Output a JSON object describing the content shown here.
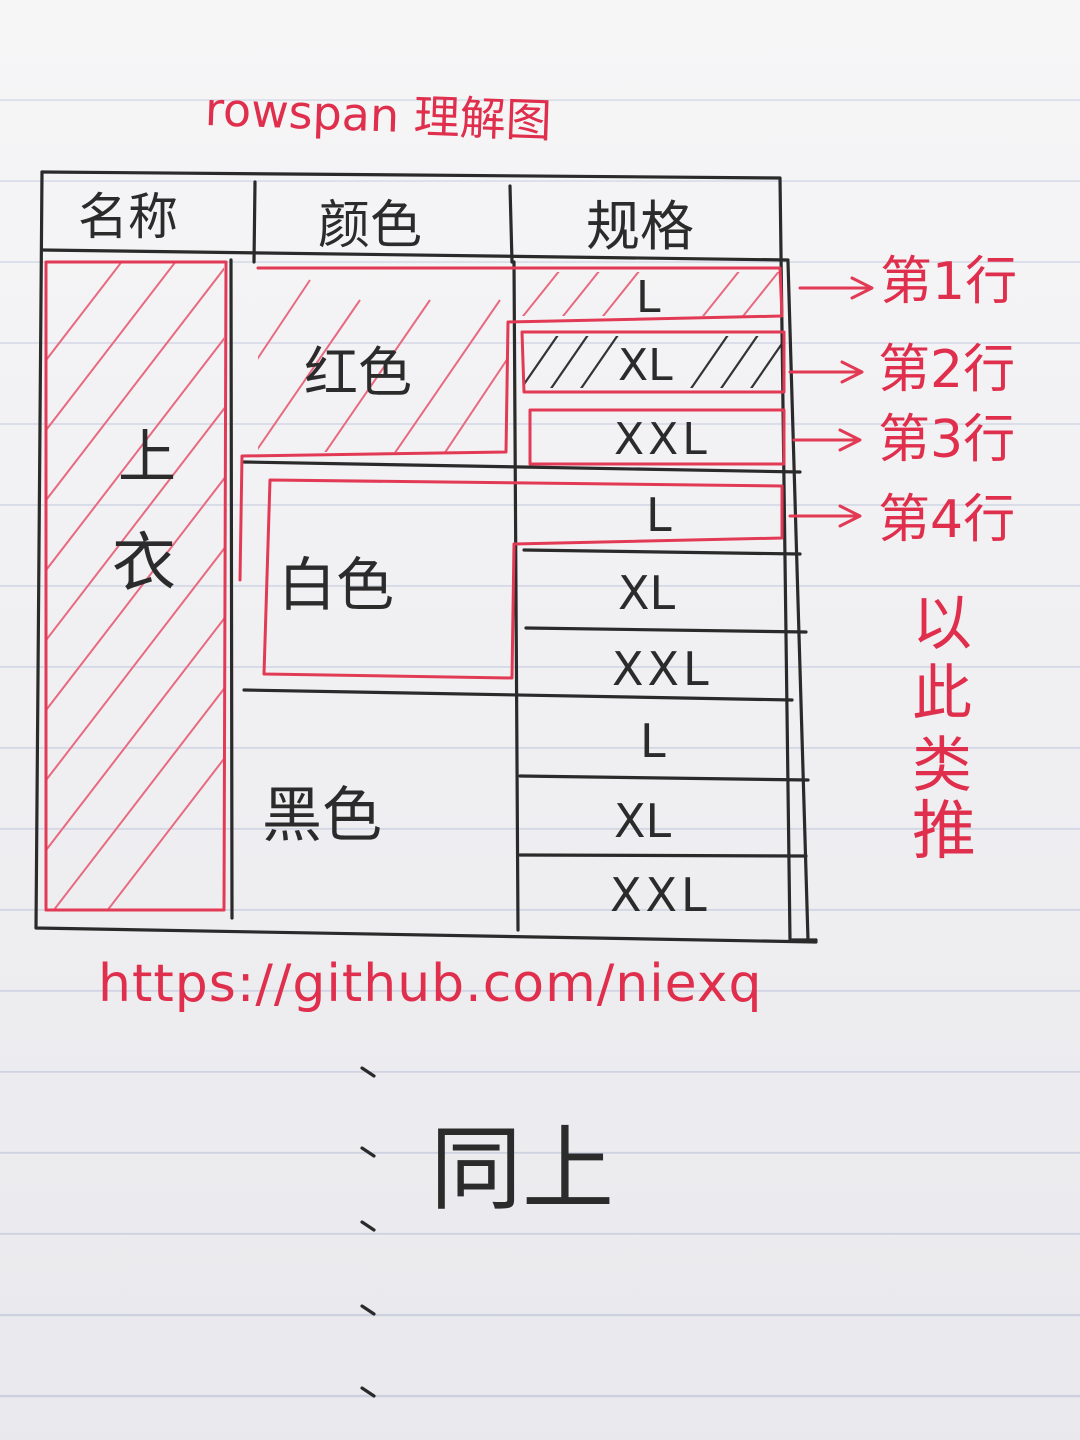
{
  "title": "rowspan 理解图",
  "table": {
    "headers": [
      "名称",
      "颜色",
      "规格"
    ],
    "name_cell": [
      "上",
      "衣"
    ],
    "colors": [
      "红色",
      "白色",
      "黑色"
    ],
    "sizes": [
      "L",
      "XL",
      "XXL",
      "L",
      "XL",
      "XXL",
      "L",
      "XL",
      "XXL"
    ]
  },
  "row_annotations": [
    "第1行",
    "第2行",
    "第3行",
    "第4行"
  ],
  "etc_note": [
    "以",
    "此",
    "类",
    "推"
  ],
  "url": "https://github.com/niexq",
  "same_as_above": "同上",
  "colors_used": {
    "ink": "#2b2b2b",
    "red": "#e02f4d",
    "paper": "#f1f1f3",
    "rule": "#c9cfe0"
  }
}
